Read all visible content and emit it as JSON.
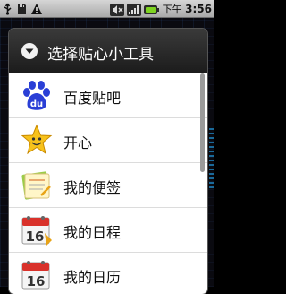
{
  "status_bar": {
    "time_prefix": "下午",
    "time": "3:56",
    "left_icons": [
      "usb-icon",
      "sd-card-icon",
      "warning-icon"
    ],
    "right_icons": [
      "mute-icon",
      "signal-icon",
      "battery-icon"
    ]
  },
  "dialog": {
    "title": "选择贴心小工具",
    "header_icon": "chevron-down-circle-icon",
    "items": [
      {
        "label": "百度贴吧",
        "icon": "baidu-paw-icon"
      },
      {
        "label": "开心",
        "icon": "smiley-star-icon"
      },
      {
        "label": "我的便签",
        "icon": "notepad-icon"
      },
      {
        "label": "我的日程",
        "icon": "calendar-16-icon"
      },
      {
        "label": "我的日历",
        "icon": "calendar-16-icon"
      }
    ]
  }
}
